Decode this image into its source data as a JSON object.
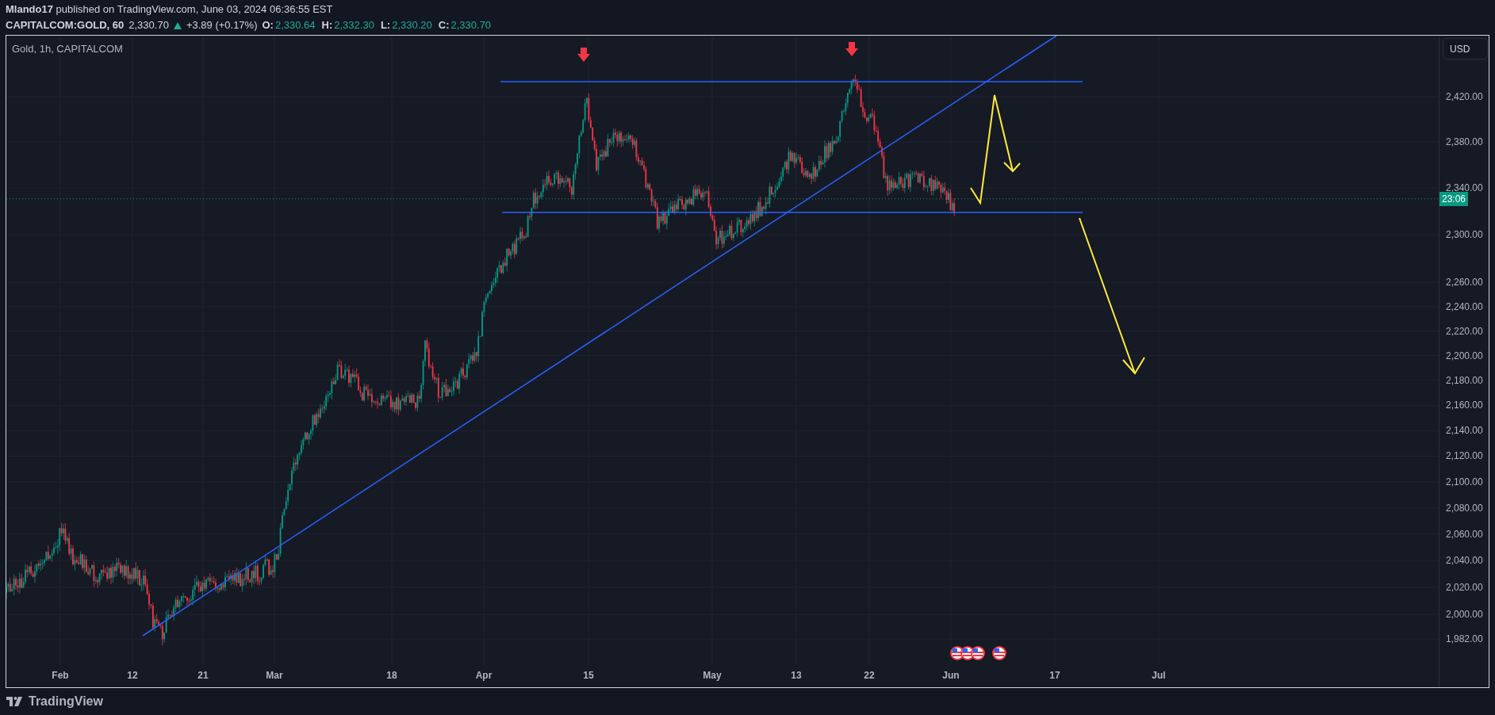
{
  "header": {
    "publish_line": "**Mlando17** published on TradingView.com, June 03, 2024 06:36:55 EST",
    "symbol": "CAPITALCOM:GOLD, 60",
    "last_price": "2,330.70",
    "change": "+3.89 (+0.17%)",
    "ohlc": [
      {
        "label": "O:",
        "value": "2,330.64"
      },
      {
        "label": "H:",
        "value": "2,332.30"
      },
      {
        "label": "L:",
        "value": "2,330.20"
      },
      {
        "label": "C:",
        "value": "2,330.70"
      }
    ]
  },
  "chart": {
    "title": "Gold, 1h, CAPITALCOM",
    "currency_button": "USD",
    "countdown": "23:06",
    "price_axis": [
      "2,420.00",
      "2,380.00",
      "2,340.00",
      "2,300.00",
      "2,260.00",
      "2,240.00",
      "2,220.00",
      "2,200.00",
      "2,180.00",
      "2,160.00",
      "2,140.00",
      "2,120.00",
      "2,100.00",
      "2,080.00",
      "2,060.00",
      "2,040.00",
      "2,020.00",
      "2,000.00",
      "1,982.00"
    ],
    "time_axis": [
      "Feb",
      "12",
      "21",
      "Mar",
      "18",
      "Apr",
      "15",
      "May",
      "13",
      "22",
      "Jun",
      "17",
      "Jul"
    ]
  },
  "footer": {
    "brand": "TradingView"
  }
}
